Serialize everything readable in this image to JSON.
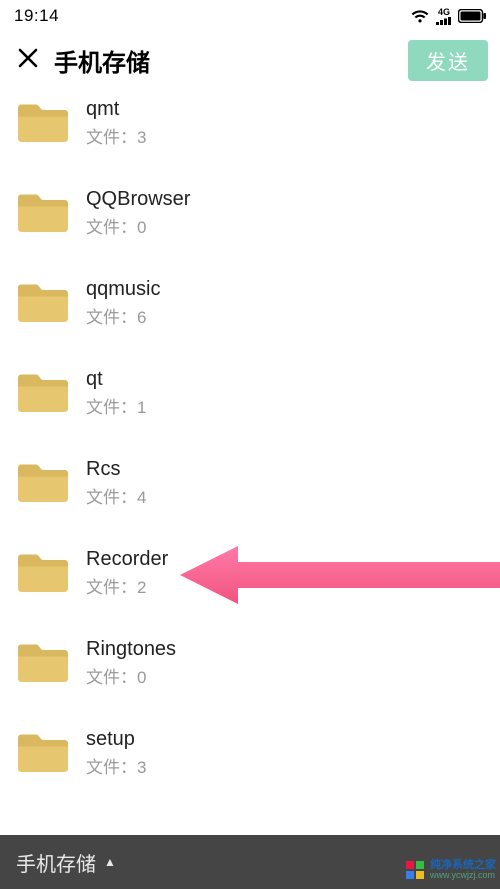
{
  "status": {
    "time": "19:14"
  },
  "header": {
    "title": "手机存储",
    "send_label": "发送"
  },
  "file_prefix": "文件：",
  "folders": [
    {
      "name": "qmt",
      "count": "3"
    },
    {
      "name": "QQBrowser",
      "count": "0"
    },
    {
      "name": "qqmusic",
      "count": "6"
    },
    {
      "name": "qt",
      "count": "1"
    },
    {
      "name": "Rcs",
      "count": "4"
    },
    {
      "name": "Recorder",
      "count": "2"
    },
    {
      "name": "Ringtones",
      "count": "0"
    },
    {
      "name": "setup",
      "count": "3"
    }
  ],
  "bottom": {
    "label": "手机存储"
  },
  "watermark": {
    "line1": "纯净系统之家",
    "line2": "www.ycwjzj.com"
  }
}
